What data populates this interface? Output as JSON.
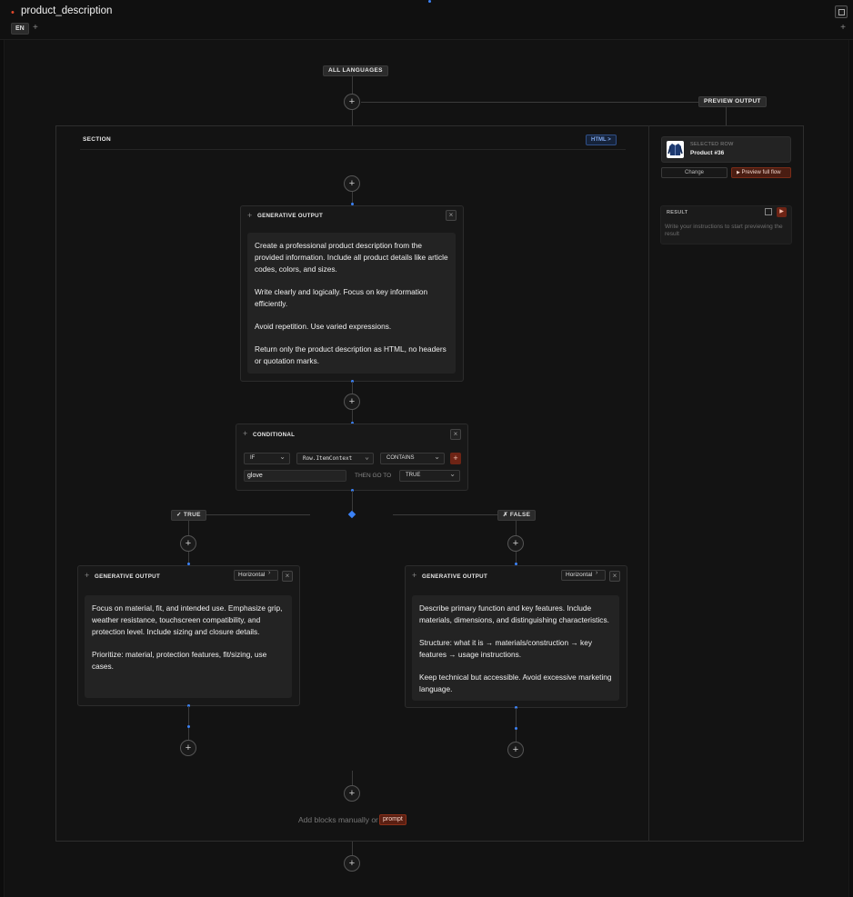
{
  "header": {
    "title": "product_description",
    "lang_tab": "EN",
    "add_label": "+",
    "right_plus": "+"
  },
  "flow": {
    "all_languages": "ALL LANGUAGES",
    "preview_output": "PREVIEW OUTPUT",
    "add_symbol": "+",
    "section": {
      "label": "SECTION",
      "format_chip": "HTML  >"
    },
    "generative_main": {
      "title": "GENERATIVE OUTPUT",
      "paragraphs": [
        "Create a professional product description from the provided information. Include all product details like article codes, colors, and sizes.",
        "Write clearly and logically. Focus on key information efficiently.",
        "Avoid repetition. Use varied expressions.",
        "Return only the product description as HTML, no headers or quotation marks."
      ]
    },
    "conditional": {
      "title": "CONDITIONAL",
      "if_value": "IF",
      "field_value": "Row.ItemContext",
      "operator_value": "CONTAINS",
      "match_value": "glove",
      "then_label": "THEN GO TO",
      "then_value": "TRUE"
    },
    "true_branch": {
      "label": "✓ TRUE",
      "title": "GENERATIVE OUTPUT",
      "layout": "Horizontal",
      "paragraphs": [
        "Focus on material, fit, and intended use. Emphasize grip, weather resistance, touchscreen compatibility, and protection level. Include sizing and closure details.",
        "Prioritize: material, protection features, fit/sizing, use cases."
      ]
    },
    "false_branch": {
      "label": "✗ FALSE",
      "title": "GENERATIVE OUTPUT",
      "layout": "Horizontal",
      "paragraphs": [
        "Describe primary function and key features. Include materials, dimensions, and distinguishing characteristics.",
        "Structure: what it is → materials/construction → key features → usage instructions.",
        "Keep technical but accessible. Avoid excessive marketing language."
      ]
    },
    "add_blocks_text": "Add blocks manually or",
    "prompt_chip": "prompt"
  },
  "preview": {
    "selected_row_label": "SELECTED ROW",
    "selected_row_value": "Product #36",
    "change_label": "Change",
    "preview_full_label": "Preview full flow",
    "result_label": "RESULT",
    "result_hint": "Write your instructions to start previewing the result"
  },
  "colors": {
    "accent": "#e0472a",
    "link_blue": "#3b82f6"
  }
}
